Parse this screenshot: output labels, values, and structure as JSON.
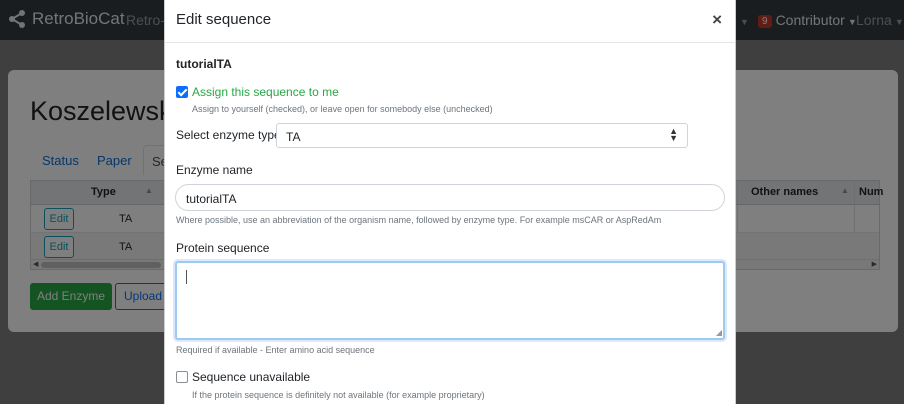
{
  "navbar": {
    "brand": "RetroBioCat",
    "link_partial": "Retro-s",
    "badge_count": "9",
    "contributor": "Contributor",
    "user": "Lorna"
  },
  "page": {
    "title_partial": "Koszelewski et",
    "tabs": [
      "Status",
      "Paper",
      "Se"
    ],
    "table_headers": [
      "Type",
      "Other names",
      "Num"
    ],
    "rows": [
      {
        "edit": "Edit",
        "type": "TA"
      },
      {
        "edit": "Edit",
        "type": "TA"
      }
    ],
    "add_button": "Add Enzyme",
    "upload_button": "Upload"
  },
  "modal": {
    "title": "Edit sequence",
    "close": "×",
    "subtitle": "tutorialTA",
    "assign_label": "Assign this sequence to me",
    "assign_checked": true,
    "assign_help": "Assign to yourself (checked), or leave open for somebody else (unchecked)",
    "select_label": "Select enzyme type",
    "select_value": "TA",
    "enzyme_name_label": "Enzyme name",
    "enzyme_name_value": "tutorialTA",
    "enzyme_name_help": "Where possible, use an abbreviation of the organism name, followed by enzyme type. For example msCAR or AspRedAm",
    "protein_label": "Protein sequence",
    "protein_value": "",
    "protein_help": "Required if available - Enter amino acid sequence",
    "unavailable_label": "Sequence unavailable",
    "unavailable_checked": false,
    "unavailable_help": "If the protein sequence is definitely not available (for example proprietary)"
  },
  "colors": {
    "navbar": "#343a40",
    "assign_green": "#28a745",
    "primary": "#0d6efd",
    "edit_teal": "#17a2b8"
  }
}
